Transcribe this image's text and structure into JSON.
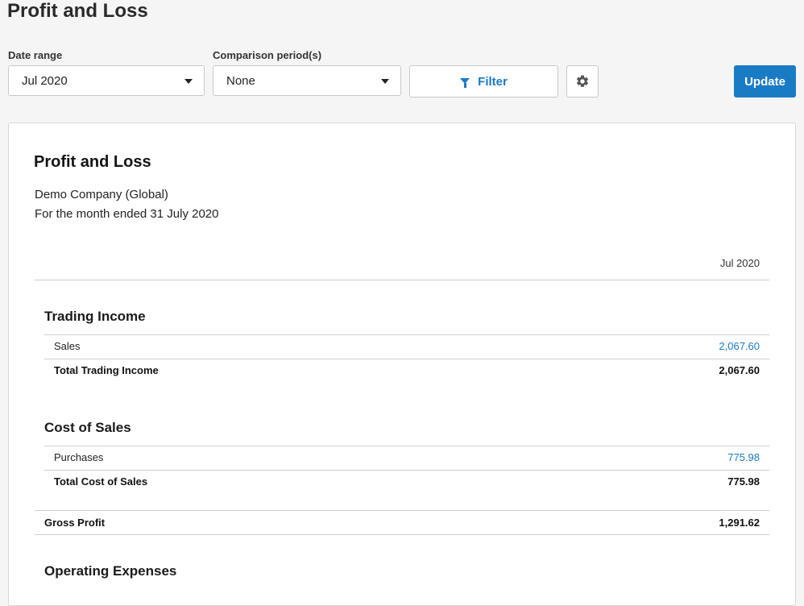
{
  "page": {
    "title": "Profit and Loss"
  },
  "controls": {
    "date_range_label": "Date range",
    "date_range_value": "Jul 2020",
    "comparison_label": "Comparison period(s)",
    "comparison_value": "None",
    "filter_label": "Filter",
    "update_label": "Update"
  },
  "report": {
    "title": "Profit and Loss",
    "company": "Demo Company (Global)",
    "period": "For the month ended 31 July 2020",
    "column_header": "Jul 2020",
    "trading_income": {
      "title": "Trading Income",
      "rows": [
        {
          "label": "Sales",
          "value": "2,067.60"
        }
      ],
      "total_label": "Total Trading Income",
      "total_value": "2,067.60"
    },
    "cost_of_sales": {
      "title": "Cost of Sales",
      "rows": [
        {
          "label": "Purchases",
          "value": "775.98"
        }
      ],
      "total_label": "Total Cost of Sales",
      "total_value": "775.98"
    },
    "gross_profit": {
      "label": "Gross Profit",
      "value": "1,291.62"
    },
    "operating_expenses": {
      "title": "Operating Expenses"
    }
  },
  "colors": {
    "accent": "#1a7bc5",
    "background": "#f5f5f5"
  }
}
